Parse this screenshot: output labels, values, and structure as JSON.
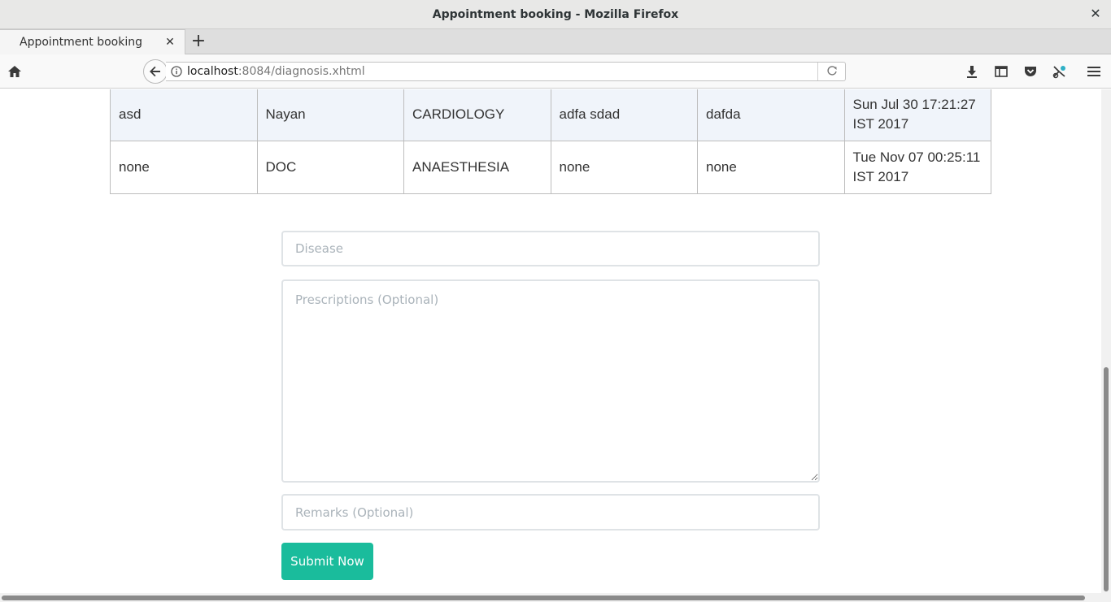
{
  "window": {
    "title": "Appointment booking - Mozilla Firefox",
    "close_glyph": "✕"
  },
  "tabs": [
    {
      "label": "Appointment booking",
      "close_glyph": "✕"
    }
  ],
  "new_tab_glyph": "+",
  "address": {
    "host": "localhost",
    "rest": ":8084/diagnosis.xhtml"
  },
  "toolbar_icons": [
    "home-icon",
    "back-arrow-icon",
    "info-icon",
    "reload-icon",
    "download-icon",
    "library-icon",
    "pocket-icon",
    "extension-icon",
    "menu-icon"
  ],
  "table": {
    "rows": [
      [
        "asd",
        "Nayan",
        "CARDIOLOGY",
        "adfa sdad",
        "dafda",
        "Sun Jul 30 17:21:27 IST 2017"
      ],
      [
        "none",
        "DOC",
        "ANAESTHESIA",
        "none",
        "none",
        "Tue Nov 07 00:25:11 IST 2017"
      ]
    ]
  },
  "form": {
    "disease_placeholder": "Disease",
    "disease_value": "",
    "prescriptions_placeholder": "Prescriptions (Optional)",
    "prescriptions_value": "",
    "remarks_placeholder": "Remarks (Optional)",
    "remarks_value": "",
    "submit_label": "Submit Now"
  },
  "colors": {
    "accent": "#1abc9c",
    "row_shade": "#f0f4fa",
    "border": "#bdbdbd"
  }
}
